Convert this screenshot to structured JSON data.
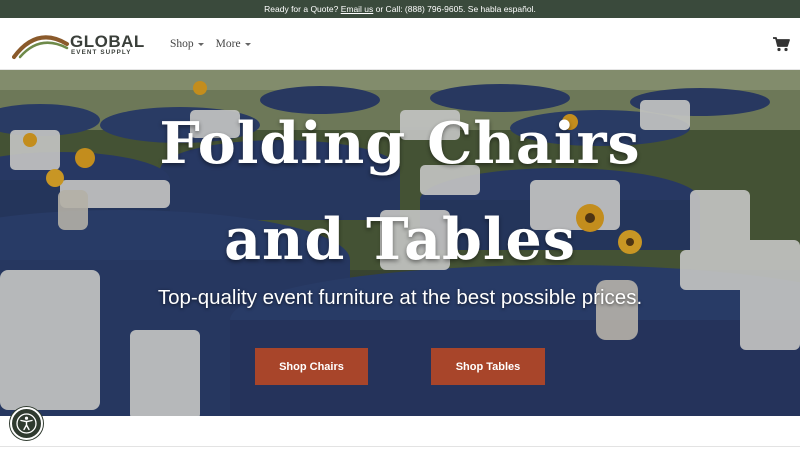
{
  "topbar": {
    "prefix": "Ready for a Quote? ",
    "link": "Email us",
    "suffix": " or Call: (888) 796-9605. Se habla español."
  },
  "header": {
    "logo_line1": "GLOBAL",
    "logo_line2": "EVENT SUPPLY",
    "nav": [
      {
        "label": "Shop"
      },
      {
        "label": "More"
      }
    ],
    "cart_icon": "shopping-cart-icon"
  },
  "hero": {
    "title_line1": "Folding Chairs",
    "title_line2": "and Tables",
    "subtitle": "Top-quality event furniture at the best possible prices.",
    "button_chairs": "Shop Chairs",
    "button_tables": "Shop Tables"
  },
  "accessibility": {
    "icon": "accessibility-icon"
  },
  "colors": {
    "topbar_bg": "#3a4a3c",
    "button_bg": "#a8452a",
    "tablecloth": "#2b3f73",
    "logo_arc_brown": "#8a5a2b",
    "logo_arc_green": "#6e8a4a"
  }
}
